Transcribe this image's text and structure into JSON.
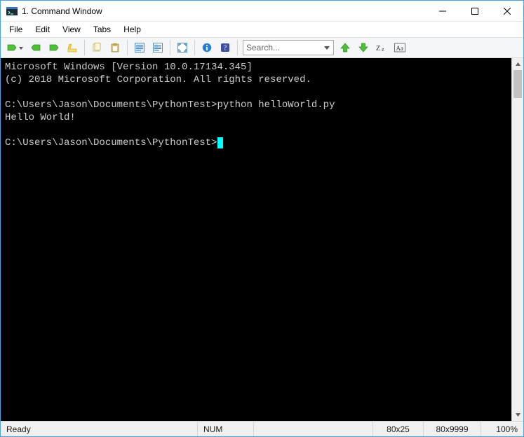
{
  "window": {
    "title": "1. Command Window"
  },
  "menubar": {
    "file": "File",
    "edit": "Edit",
    "view": "View",
    "tabs": "Tabs",
    "help": "Help"
  },
  "toolbar": {
    "search_placeholder": "Search..."
  },
  "terminal": {
    "line1": "Microsoft Windows [Version 10.0.17134.345]",
    "line2": "(c) 2018 Microsoft Corporation. All rights reserved.",
    "blank1": "",
    "prompt1_path": "C:\\Users\\Jason\\Documents\\PythonTest>",
    "prompt1_cmd": "python helloWorld.py",
    "output1": "Hello World!",
    "blank2": "",
    "prompt2_path": "C:\\Users\\Jason\\Documents\\PythonTest>"
  },
  "statusbar": {
    "ready": "Ready",
    "num": "NUM",
    "dimensions": "80x25",
    "buffer": "80x9999",
    "zoom": "100%"
  }
}
